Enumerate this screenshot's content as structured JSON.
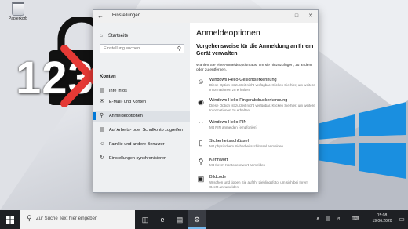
{
  "desktop": {
    "recycle_bin_label": "Papierkorb",
    "overlay_digits": "12345",
    "overlay_icon": "padlock-crossed-icon"
  },
  "window": {
    "title": "Einstellungen",
    "sidebar": {
      "home_label": "Startseite",
      "search_placeholder": "Einstellung suchen",
      "section_label": "Konten",
      "items": [
        {
          "label": "Ihre Infos",
          "icon": "person-card-icon"
        },
        {
          "label": "E-Mail- und Konten",
          "icon": "mail-icon"
        },
        {
          "label": "Anmeldeoptionen",
          "icon": "key-icon"
        },
        {
          "label": "Auf Arbeits- oder Schulkonto zugreifen",
          "icon": "briefcase-icon"
        },
        {
          "label": "Familie und andere Benutzer",
          "icon": "people-icon"
        },
        {
          "label": "Einstellungen synchronisieren",
          "icon": "sync-icon"
        }
      ]
    },
    "main": {
      "title": "Anmeldeoptionen",
      "subtitle": "Vorgehensweise für die Anmeldung an Ihrem Gerät verwalten",
      "intro": "Wählen Sie eine Anmeldeoption aus, um sie hinzuzufügen, zu ändern oder zu entfernen.",
      "options": [
        {
          "title": "Windows Hello-Gesichtserkennung",
          "desc": "Diese Option ist zurzeit nicht verfügbar. Klicken Sie hier, um weitere Informationen zu erhalten",
          "icon": "face-icon"
        },
        {
          "title": "Windows Hello-Fingerabdruckerkennung",
          "desc": "Diese Option ist zurzeit nicht verfügbar. Klicken Sie hier, um weitere Informationen zu erhalten",
          "icon": "fingerprint-icon"
        },
        {
          "title": "Windows Hello-PIN",
          "desc": "Mit PIN anmelden (empfohlen)",
          "icon": "pin-keypad-icon"
        },
        {
          "title": "Sicherheitsschlüssel",
          "desc": "Mit physischem Sicherheitsschlüssel anmelden",
          "icon": "usb-key-icon"
        },
        {
          "title": "Kennwort",
          "desc": "Mit Ihrem Kontokennwort anmelden",
          "icon": "key-icon"
        },
        {
          "title": "Bildcode",
          "desc": "Wischen und tippen Sie auf Ihr Lieblingsfoto, um sich bei Ihrem Gerät anzumelden",
          "icon": "picture-icon"
        }
      ]
    }
  },
  "taskbar": {
    "search_placeholder": "Zur Suche Text hier eingeben",
    "time": "15:08",
    "date": "19.06.2020",
    "colors": {
      "accent": "#0078d7",
      "taskbar": "#1e2024"
    }
  }
}
